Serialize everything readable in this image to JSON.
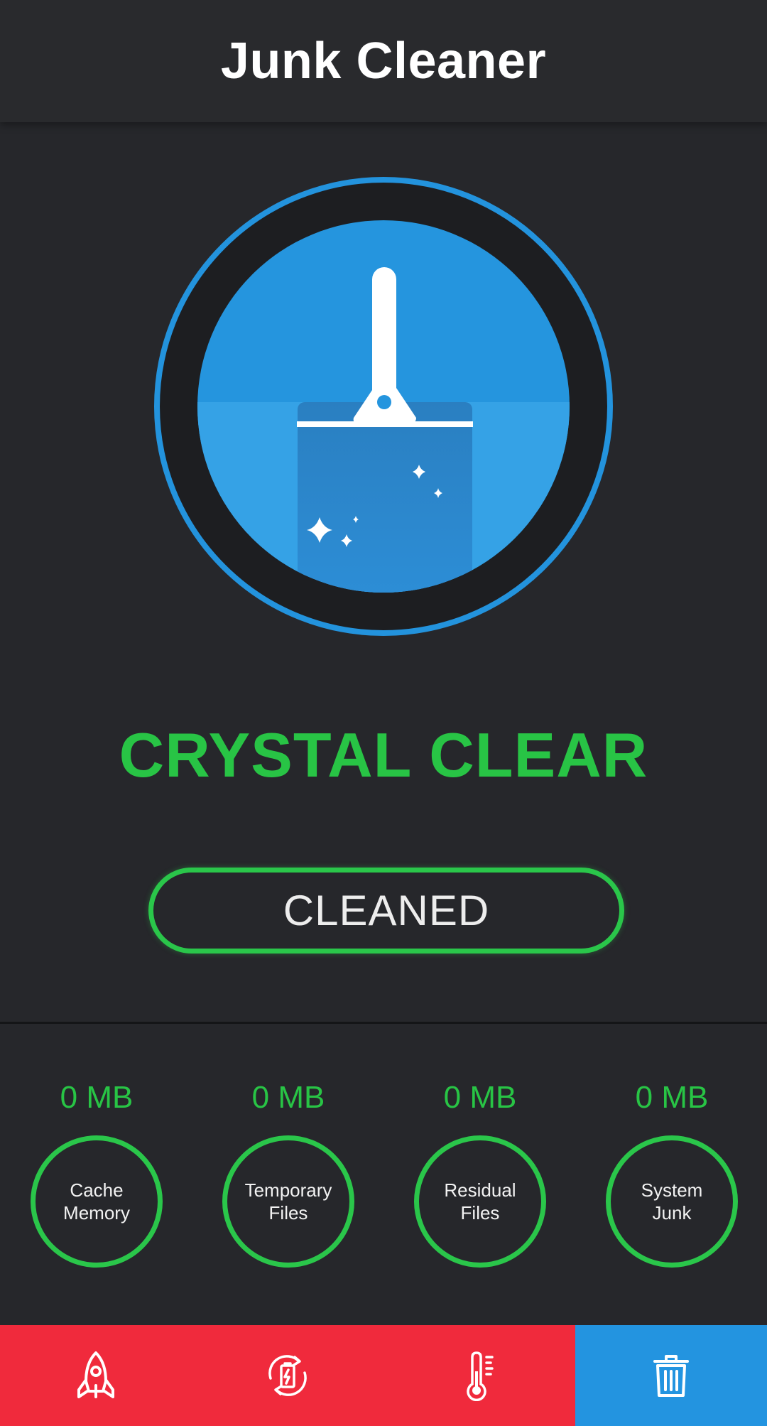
{
  "header": {
    "title": "Junk Cleaner"
  },
  "status": {
    "title": "CRYSTAL CLEAR",
    "button_label": "CLEANED"
  },
  "stats": [
    {
      "value": "0 MB",
      "label_line1": "Cache",
      "label_line2": "Memory"
    },
    {
      "value": "0 MB",
      "label_line1": "Temporary",
      "label_line2": "Files"
    },
    {
      "value": "0 MB",
      "label_line1": "Residual",
      "label_line2": "Files"
    },
    {
      "value": "0 MB",
      "label_line1": "System",
      "label_line2": "Junk"
    }
  ],
  "nav": [
    {
      "icon": "rocket-icon",
      "active": false
    },
    {
      "icon": "battery-refresh-icon",
      "active": false
    },
    {
      "icon": "thermometer-icon",
      "active": false
    },
    {
      "icon": "trash-icon",
      "active": true
    }
  ],
  "colors": {
    "background": "#26272b",
    "accent_green": "#28c445",
    "accent_blue": "#2394e0",
    "nav_red": "#f02a3c"
  }
}
